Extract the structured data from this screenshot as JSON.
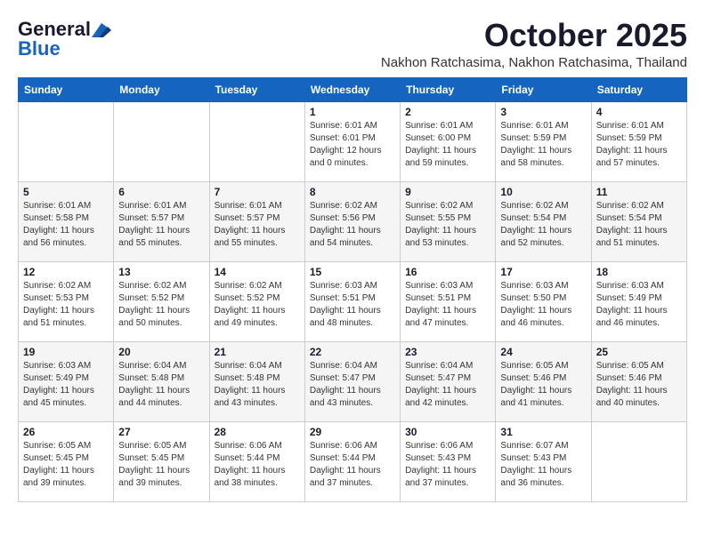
{
  "logo": {
    "general": "General",
    "blue": "Blue"
  },
  "header": {
    "month": "October 2025",
    "location": "Nakhon Ratchasima, Nakhon Ratchasima, Thailand"
  },
  "weekdays": [
    "Sunday",
    "Monday",
    "Tuesday",
    "Wednesday",
    "Thursday",
    "Friday",
    "Saturday"
  ],
  "rows": [
    [
      {
        "day": "",
        "info": ""
      },
      {
        "day": "",
        "info": ""
      },
      {
        "day": "",
        "info": ""
      },
      {
        "day": "1",
        "info": "Sunrise: 6:01 AM\nSunset: 6:01 PM\nDaylight: 12 hours\nand 0 minutes."
      },
      {
        "day": "2",
        "info": "Sunrise: 6:01 AM\nSunset: 6:00 PM\nDaylight: 11 hours\nand 59 minutes."
      },
      {
        "day": "3",
        "info": "Sunrise: 6:01 AM\nSunset: 5:59 PM\nDaylight: 11 hours\nand 58 minutes."
      },
      {
        "day": "4",
        "info": "Sunrise: 6:01 AM\nSunset: 5:59 PM\nDaylight: 11 hours\nand 57 minutes."
      }
    ],
    [
      {
        "day": "5",
        "info": "Sunrise: 6:01 AM\nSunset: 5:58 PM\nDaylight: 11 hours\nand 56 minutes."
      },
      {
        "day": "6",
        "info": "Sunrise: 6:01 AM\nSunset: 5:57 PM\nDaylight: 11 hours\nand 55 minutes."
      },
      {
        "day": "7",
        "info": "Sunrise: 6:01 AM\nSunset: 5:57 PM\nDaylight: 11 hours\nand 55 minutes."
      },
      {
        "day": "8",
        "info": "Sunrise: 6:02 AM\nSunset: 5:56 PM\nDaylight: 11 hours\nand 54 minutes."
      },
      {
        "day": "9",
        "info": "Sunrise: 6:02 AM\nSunset: 5:55 PM\nDaylight: 11 hours\nand 53 minutes."
      },
      {
        "day": "10",
        "info": "Sunrise: 6:02 AM\nSunset: 5:54 PM\nDaylight: 11 hours\nand 52 minutes."
      },
      {
        "day": "11",
        "info": "Sunrise: 6:02 AM\nSunset: 5:54 PM\nDaylight: 11 hours\nand 51 minutes."
      }
    ],
    [
      {
        "day": "12",
        "info": "Sunrise: 6:02 AM\nSunset: 5:53 PM\nDaylight: 11 hours\nand 51 minutes."
      },
      {
        "day": "13",
        "info": "Sunrise: 6:02 AM\nSunset: 5:52 PM\nDaylight: 11 hours\nand 50 minutes."
      },
      {
        "day": "14",
        "info": "Sunrise: 6:02 AM\nSunset: 5:52 PM\nDaylight: 11 hours\nand 49 minutes."
      },
      {
        "day": "15",
        "info": "Sunrise: 6:03 AM\nSunset: 5:51 PM\nDaylight: 11 hours\nand 48 minutes."
      },
      {
        "day": "16",
        "info": "Sunrise: 6:03 AM\nSunset: 5:51 PM\nDaylight: 11 hours\nand 47 minutes."
      },
      {
        "day": "17",
        "info": "Sunrise: 6:03 AM\nSunset: 5:50 PM\nDaylight: 11 hours\nand 46 minutes."
      },
      {
        "day": "18",
        "info": "Sunrise: 6:03 AM\nSunset: 5:49 PM\nDaylight: 11 hours\nand 46 minutes."
      }
    ],
    [
      {
        "day": "19",
        "info": "Sunrise: 6:03 AM\nSunset: 5:49 PM\nDaylight: 11 hours\nand 45 minutes."
      },
      {
        "day": "20",
        "info": "Sunrise: 6:04 AM\nSunset: 5:48 PM\nDaylight: 11 hours\nand 44 minutes."
      },
      {
        "day": "21",
        "info": "Sunrise: 6:04 AM\nSunset: 5:48 PM\nDaylight: 11 hours\nand 43 minutes."
      },
      {
        "day": "22",
        "info": "Sunrise: 6:04 AM\nSunset: 5:47 PM\nDaylight: 11 hours\nand 43 minutes."
      },
      {
        "day": "23",
        "info": "Sunrise: 6:04 AM\nSunset: 5:47 PM\nDaylight: 11 hours\nand 42 minutes."
      },
      {
        "day": "24",
        "info": "Sunrise: 6:05 AM\nSunset: 5:46 PM\nDaylight: 11 hours\nand 41 minutes."
      },
      {
        "day": "25",
        "info": "Sunrise: 6:05 AM\nSunset: 5:46 PM\nDaylight: 11 hours\nand 40 minutes."
      }
    ],
    [
      {
        "day": "26",
        "info": "Sunrise: 6:05 AM\nSunset: 5:45 PM\nDaylight: 11 hours\nand 39 minutes."
      },
      {
        "day": "27",
        "info": "Sunrise: 6:05 AM\nSunset: 5:45 PM\nDaylight: 11 hours\nand 39 minutes."
      },
      {
        "day": "28",
        "info": "Sunrise: 6:06 AM\nSunset: 5:44 PM\nDaylight: 11 hours\nand 38 minutes."
      },
      {
        "day": "29",
        "info": "Sunrise: 6:06 AM\nSunset: 5:44 PM\nDaylight: 11 hours\nand 37 minutes."
      },
      {
        "day": "30",
        "info": "Sunrise: 6:06 AM\nSunset: 5:43 PM\nDaylight: 11 hours\nand 37 minutes."
      },
      {
        "day": "31",
        "info": "Sunrise: 6:07 AM\nSunset: 5:43 PM\nDaylight: 11 hours\nand 36 minutes."
      },
      {
        "day": "",
        "info": ""
      }
    ]
  ]
}
